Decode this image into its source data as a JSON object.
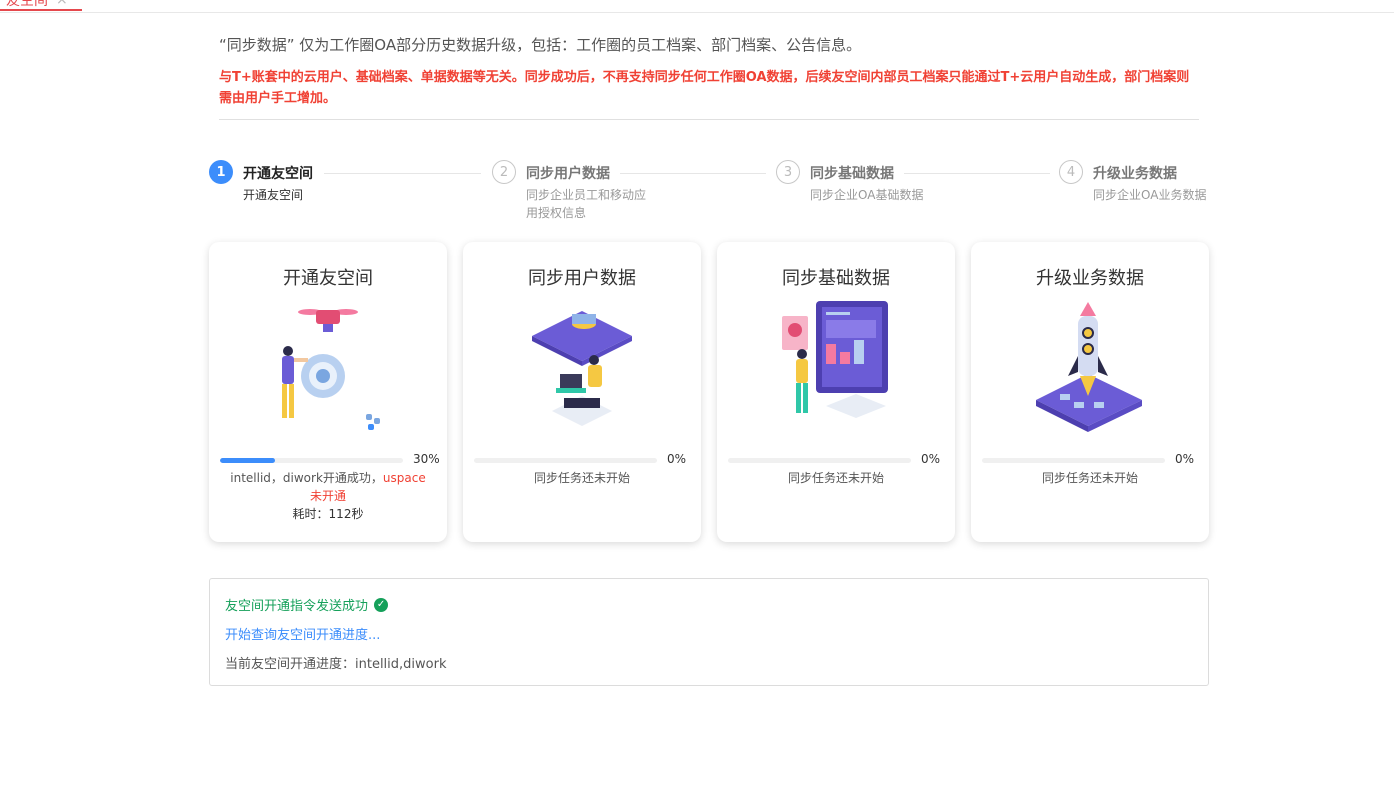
{
  "tab": {
    "label": "友空间",
    "close": "×"
  },
  "intro": "“同步数据” 仅为工作圈OA部分历史数据升级，包括：工作圈的员工档案、部门档案、公告信息。",
  "warning": "与T+账套中的云用户、基础档案、单据数据等无关。同步成功后，不再支持同步任何工作圈OA数据，后续友空间内部员工档案只能通过T+云用户自动生成，部门档案则需由用户手工增加。",
  "steps": [
    {
      "num": "1",
      "title": "开通友空间",
      "desc": "开通友空间",
      "state": "active"
    },
    {
      "num": "2",
      "title": "同步用户数据",
      "desc": "同步企业员工和移动应用授权信息",
      "state": "todo"
    },
    {
      "num": "3",
      "title": "同步基础数据",
      "desc": "同步企业OA基础数据",
      "state": "todo"
    },
    {
      "num": "4",
      "title": "升级业务数据",
      "desc": "同步企业OA业务数据",
      "state": "todo"
    }
  ],
  "cards": [
    {
      "title": "开通友空间",
      "progress": 30,
      "pct_label": "30%",
      "status_prefix": "intellid，diwork开通成功，",
      "status_red": "uspace未开通",
      "time": "耗时：112秒"
    },
    {
      "title": "同步用户数据",
      "progress": 0,
      "pct_label": "0%",
      "status": "同步任务还未开始"
    },
    {
      "title": "同步基础数据",
      "progress": 0,
      "pct_label": "0%",
      "status": "同步任务还未开始"
    },
    {
      "title": "升级业务数据",
      "progress": 0,
      "pct_label": "0%",
      "status": "同步任务还未开始"
    }
  ],
  "log": {
    "line1": "友空间开通指令发送成功",
    "line2": "开始查询友空间开通进度...",
    "line3": "当前友空间开通进度：intellid,diwork"
  },
  "colors": {
    "primary": "#3c8dfb",
    "danger": "#f04134",
    "success": "#15a05a"
  }
}
